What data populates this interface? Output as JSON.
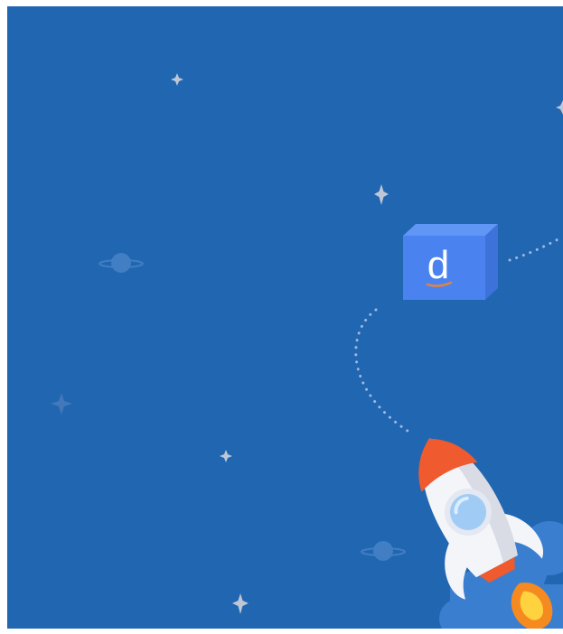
{
  "illustration": {
    "logo_letter": "d",
    "icons": [
      "sparkle-star-icon",
      "planet-icon",
      "logo-cube-icon",
      "rocket-icon",
      "flame-icon",
      "cloud-icon"
    ],
    "colors": {
      "background": "#2066B1",
      "cube_front": "#4A83F0",
      "cube_side": "#3D72DA",
      "cube_top": "#6096F6",
      "logo_letter": "#FFFFFF",
      "logo_underline": "#E8823A",
      "trail": "#9DB8E2",
      "star": "#BFC7D6",
      "planet": "#4C86C9",
      "rocket_body": "#F4F5F8",
      "rocket_shade": "#D9DCE4",
      "rocket_nose": "#EF5A2E",
      "rocket_window": "#9FCBF5",
      "flame_outer": "#F58A20",
      "flame_inner": "#FFD23F",
      "cloud": "#3A7ED0"
    }
  }
}
